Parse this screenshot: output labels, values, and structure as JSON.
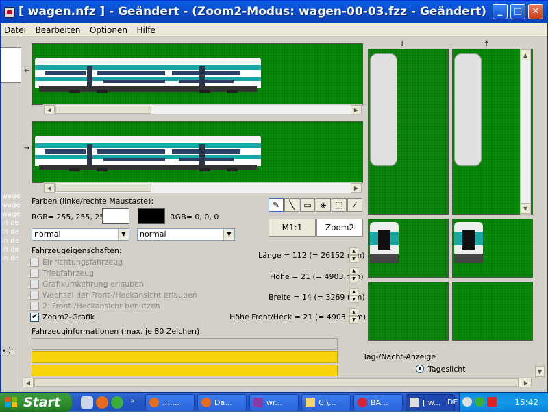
{
  "window": {
    "title": "[ wagen.nfz ] - Geändert - (Zoom2-Modus: wagen-00-03.fzz - Geändert)",
    "minimize": "_",
    "maximize": "□",
    "close": "✕"
  },
  "menu": [
    "Datei",
    "Bearbeiten",
    "Optionen",
    "Hilfe"
  ],
  "left_strip": {
    "lines": [
      "wage",
      "wage",
      "wage",
      "in de",
      "in de",
      "in de",
      "in de",
      "in de"
    ],
    "trailer": "x.):"
  },
  "tools": {
    "items": [
      "pencil-icon",
      "line-icon",
      "rectangle-icon",
      "fill-icon",
      "select-icon",
      "picker-icon"
    ],
    "scale_buttons": [
      "M1:1",
      "Zoom2"
    ]
  },
  "colors": {
    "heading": "Farben (linke/rechte Maustaste):",
    "left_rgb": "RGB= 255, 255, 255",
    "right_rgb": "RGB= 0, 0, 0",
    "left_hex": "#ffffff",
    "right_hex": "#000000",
    "left_mode": "normal",
    "right_mode": "normal"
  },
  "properties": {
    "heading": "Fahrzeugeigenschaften:",
    "items": [
      {
        "label": "Einrichtungsfahrzeug",
        "checked": false
      },
      {
        "label": "Triebfahrzeug",
        "checked": false
      },
      {
        "label": "Grafikumkehrung erlauben",
        "checked": false
      },
      {
        "label": "Wechsel der Front-/Heckansicht erlauben",
        "checked": false
      },
      {
        "label": "2. Front-/Heckansicht benutzen",
        "checked": false
      },
      {
        "label": "Zoom2-Grafik",
        "checked": true
      }
    ]
  },
  "dimensions": {
    "length": "Länge = 112 (= 26152 mm)",
    "height": "Höhe = 21 (= 4903 mm)",
    "width": "Breite = 14 (= 3269 mm)",
    "front_height": "Höhe Front/Heck = 21 (= 4903 mm)"
  },
  "info": {
    "heading": "Fahrzeuginformationen (max. je 80 Zeichen)"
  },
  "daynight": {
    "heading": "Tag-/Nacht-Anzeige",
    "option1": "Tageslicht"
  },
  "accent": {
    "panel_green": "#0a8a0a",
    "info_yellow": "#f7d30b",
    "train_teal": "#1aa6a6"
  },
  "taskbar": {
    "start": "Start",
    "items": [
      ".::....",
      "Da...",
      "wr...",
      "C:\\...",
      "BA...",
      "[ w..."
    ],
    "lang": "DE",
    "clock": "15:42"
  }
}
